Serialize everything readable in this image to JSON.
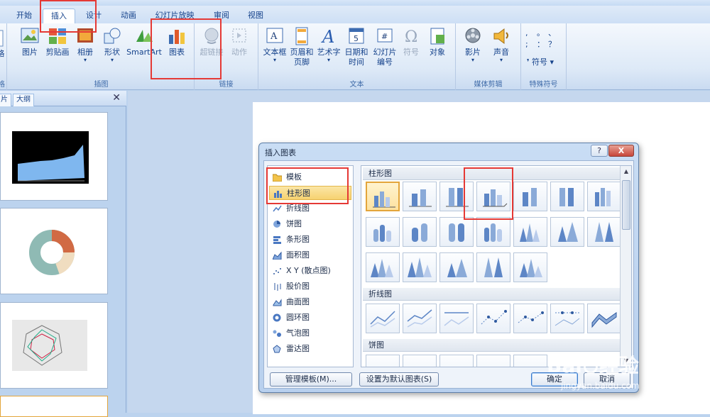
{
  "tabs": [
    "开始",
    "插入",
    "设计",
    "动画",
    "幻灯片放映",
    "审阅",
    "视图"
  ],
  "active_tab": "插入",
  "ribbon": {
    "tables_group_fragment": "格",
    "tables_label_fragment": "格",
    "groups": {
      "illustrations": {
        "label": "插图",
        "items": [
          "图片",
          "剪贴画",
          "相册",
          "形状",
          "SmartArt",
          "图表"
        ]
      },
      "links": {
        "label": "链接",
        "items": [
          "超链接",
          "动作"
        ]
      },
      "text": {
        "label": "文本",
        "items": [
          [
            "文本框",
            ""
          ],
          [
            "页眉和",
            "页脚"
          ],
          [
            "艺术字",
            ""
          ],
          [
            "日期和",
            "时间"
          ],
          [
            "幻灯片",
            "编号"
          ],
          [
            "符号",
            ""
          ],
          [
            "对象",
            ""
          ]
        ]
      },
      "media": {
        "label": "媒体剪辑",
        "items": [
          "影片",
          "声音"
        ]
      },
      "special": {
        "label": "特殊符号",
        "symbols": [
          ",",
          "。",
          "、",
          ";",
          "：",
          "？"
        ],
        "button": "符号"
      }
    }
  },
  "left_pane": {
    "tab1": "片",
    "tab2": "大纲",
    "close": "✕"
  },
  "dialog": {
    "title": "插入图表",
    "help": "?",
    "close": "X",
    "categories": [
      "模板",
      "柱形图",
      "折线图",
      "饼图",
      "条形图",
      "面积图",
      "X Y (散点图)",
      "股价图",
      "曲面图",
      "圆环图",
      "气泡图",
      "雷达图"
    ],
    "selected_category": "柱形图",
    "sections": [
      "柱形图",
      "折线图",
      "饼图"
    ],
    "buttons": {
      "manage": "管理模板(M)...",
      "set_default": "设置为默认图表(S)",
      "ok": "确定",
      "cancel": "取消"
    }
  },
  "watermark": {
    "brand": "Bai",
    "brand2": "经验",
    "url": "jingyan.baidu.com"
  },
  "colors": {
    "accent": "#e53935",
    "selected": "#f6d270"
  }
}
